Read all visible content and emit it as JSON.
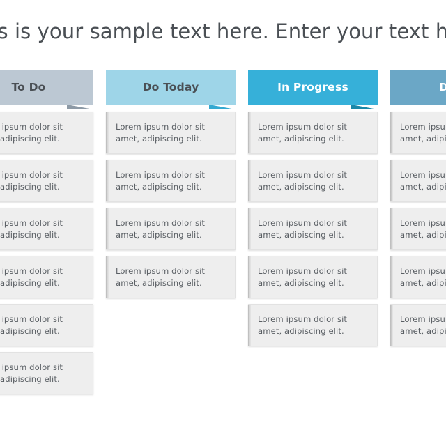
{
  "slide": {
    "title": "This is your sample text here. Enter your text here.",
    "background_color": "#ffffff",
    "title_color": "#4a4f54"
  },
  "board": {
    "card_text": "Lorem ipsum dolor sit amet, adipiscing elit.",
    "columns": [
      {
        "id": "to-do",
        "label": "To Do",
        "header_color": "#bcc8d3",
        "fold_color": "#8d9aa6",
        "label_color": "#4a4f54",
        "cards": [
          {
            "text": "Lorem ipsum dolor sit amet, adipiscing elit."
          },
          {
            "text": "Lorem ipsum dolor sit amet, adipiscing elit."
          },
          {
            "text": "Lorem ipsum dolor sit amet, adipiscing elit."
          },
          {
            "text": "Lorem ipsum dolor sit amet, adipiscing elit."
          },
          {
            "text": "Lorem ipsum dolor sit amet, adipiscing elit."
          },
          {
            "text": "Lorem ipsum dolor sit amet, adipiscing elit."
          }
        ]
      },
      {
        "id": "do-today",
        "label": "Do Today",
        "header_color": "#9ed5e8",
        "fold_color": "#35a9d1",
        "label_color": "#4a4f54",
        "cards": [
          {
            "text": "Lorem ipsum dolor sit amet, adipiscing elit."
          },
          {
            "text": "Lorem ipsum dolor sit amet, adipiscing elit."
          },
          {
            "text": "Lorem ipsum dolor sit amet, adipiscing elit."
          },
          {
            "text": "Lorem ipsum dolor sit amet, adipiscing elit."
          }
        ]
      },
      {
        "id": "in-progress",
        "label": "In Progress",
        "header_color": "#36b0d9",
        "fold_color": "#1b87a8",
        "label_color": "#ffffff",
        "cards": [
          {
            "text": "Lorem ipsum dolor sit amet, adipiscing elit."
          },
          {
            "text": "Lorem ipsum dolor sit amet, adipiscing elit."
          },
          {
            "text": "Lorem ipsum dolor sit amet, adipiscing elit."
          },
          {
            "text": "Lorem ipsum dolor sit amet, adipiscing elit."
          },
          {
            "text": "Lorem ipsum dolor sit amet, adipiscing elit."
          }
        ]
      },
      {
        "id": "done",
        "label": "Done",
        "header_color": "#6ba7c6",
        "fold_color": "#4a849f",
        "label_color": "#ffffff",
        "cards": [
          {
            "text": "Lorem ipsum dolor sit amet, adipiscing elit."
          },
          {
            "text": "Lorem ipsum dolor sit amet, adipiscing elit."
          },
          {
            "text": "Lorem ipsum dolor sit amet, adipiscing elit."
          },
          {
            "text": "Lorem ipsum dolor sit amet, adipiscing elit."
          },
          {
            "text": "Lorem ipsum dolor sit amet, adipiscing elit."
          }
        ]
      }
    ]
  }
}
